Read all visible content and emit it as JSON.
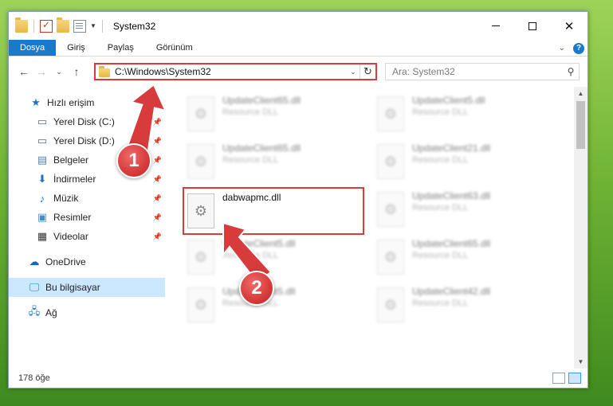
{
  "window": {
    "title": "System32"
  },
  "ribbon": {
    "tabs": [
      {
        "label": "Dosya",
        "active": true
      },
      {
        "label": "Giriş"
      },
      {
        "label": "Paylaş"
      },
      {
        "label": "Görünüm"
      }
    ],
    "help": "?"
  },
  "nav": {
    "address": "C:\\Windows\\System32",
    "search_placeholder": "Ara: System32"
  },
  "sidebar": {
    "items": [
      {
        "label": "Hızlı erişim",
        "icon": "star-icon",
        "pinned": false
      },
      {
        "label": "Yerel Disk (C:)",
        "icon": "drive-icon",
        "pinned": true
      },
      {
        "label": "Yerel Disk (D:)",
        "icon": "drive-icon",
        "pinned": true
      },
      {
        "label": "Belgeler",
        "icon": "documents-icon",
        "pinned": true
      },
      {
        "label": "İndirmeler",
        "icon": "download-icon",
        "pinned": true
      },
      {
        "label": "Müzik",
        "icon": "music-icon",
        "pinned": true
      },
      {
        "label": "Resimler",
        "icon": "pictures-icon",
        "pinned": true
      },
      {
        "label": "Videolar",
        "icon": "video-icon",
        "pinned": true
      },
      {
        "label": "OneDrive",
        "icon": "cloud-icon"
      },
      {
        "label": "Bu bilgisayar",
        "icon": "computer-icon",
        "selected": true
      },
      {
        "label": "Ağ",
        "icon": "network-icon"
      }
    ]
  },
  "files": [
    {
      "name": "UpdateClient65.dll",
      "type": "Resource DLL",
      "blurred": true
    },
    {
      "name": "UpdateClient5.dll",
      "type": "Resource DLL",
      "blurred": true
    },
    {
      "name": "UpdateClient65.dll",
      "type": "Resource DLL",
      "blurred": true
    },
    {
      "name": "UpdateClient21.dll",
      "type": "Resource DLL",
      "blurred": true
    },
    {
      "name": "dabwapmc.dll",
      "type": "",
      "blurred": false,
      "highlighted": true
    },
    {
      "name": "UpdateClient63.dll",
      "type": "Resource DLL",
      "blurred": true
    },
    {
      "name": "UpdateClient5.dll",
      "type": "Resource DLL",
      "blurred": true
    },
    {
      "name": "UpdateClient65.dll",
      "type": "Resource DLL",
      "blurred": true
    },
    {
      "name": "UpdateClient5.dll",
      "type": "Resource DLL",
      "blurred": true
    },
    {
      "name": "UpdateClient42.dll",
      "type": "Resource DLL",
      "blurred": true
    }
  ],
  "status": {
    "item_count": "178 öğe"
  },
  "annotations": {
    "step1": "1",
    "step2": "2",
    "color": "#d83b3b"
  }
}
